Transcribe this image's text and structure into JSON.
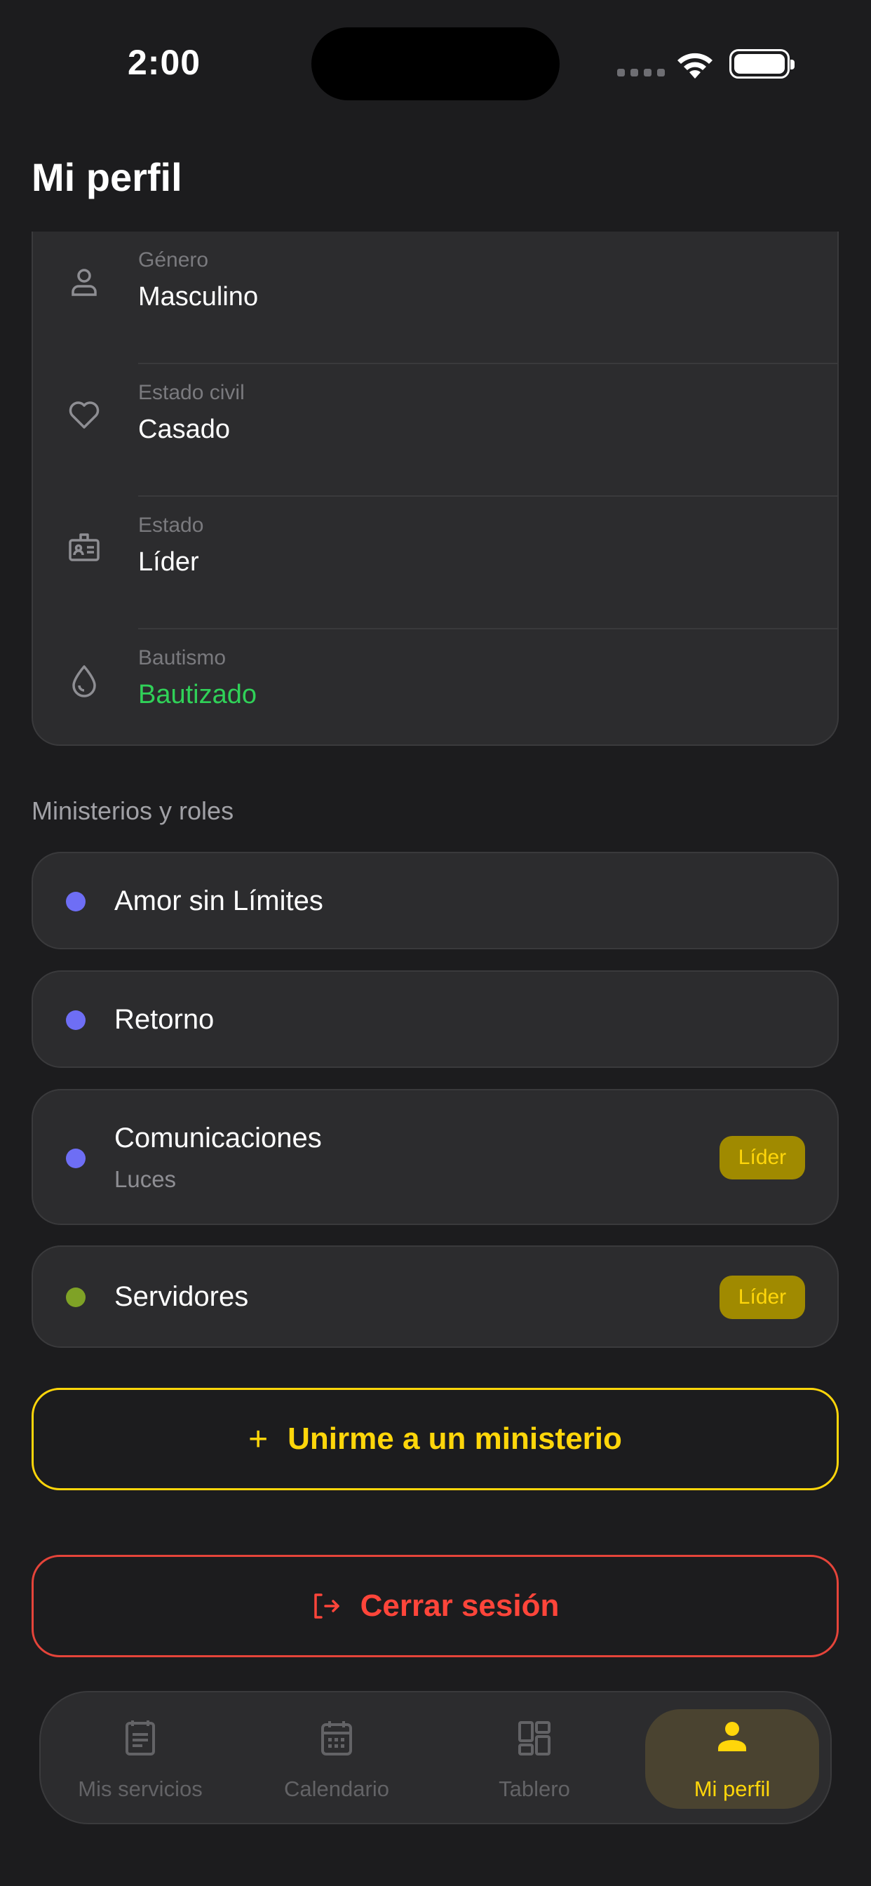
{
  "status_bar": {
    "time": "2:00"
  },
  "header": {
    "title": "Mi perfil"
  },
  "info": [
    {
      "label": "Género",
      "value": "Masculino",
      "icon": "person-icon"
    },
    {
      "label": "Estado civil",
      "value": "Casado",
      "icon": "heart-icon"
    },
    {
      "label": "Estado",
      "value": "Líder",
      "icon": "badge-icon"
    },
    {
      "label": "Bautismo",
      "value": "Bautizado",
      "icon": "drop-icon",
      "value_color": "#30d158"
    }
  ],
  "ministries_section": {
    "title": "Ministerios y roles"
  },
  "ministries": [
    {
      "name": "Amor sin Límites",
      "dot_color": "#6e6ef5"
    },
    {
      "name": "Retorno",
      "dot_color": "#6e6ef5"
    },
    {
      "name": "Comunicaciones",
      "sub": "Luces",
      "badge": "Líder",
      "dot_color": "#6e6ef5"
    },
    {
      "name": "Servidores",
      "badge": "Líder",
      "dot_color": "#7fa226"
    }
  ],
  "actions": {
    "join_icon": "+",
    "join_label": "Unirme a un ministerio",
    "logout_label": "Cerrar sesión"
  },
  "tabs": [
    {
      "label": "Mis servicios",
      "icon": "document-icon",
      "active": false
    },
    {
      "label": "Calendario",
      "icon": "calendar-icon",
      "active": false
    },
    {
      "label": "Tablero",
      "icon": "dashboard-icon",
      "active": false
    },
    {
      "label": "Mi perfil",
      "icon": "person-icon",
      "active": true
    }
  ],
  "colors": {
    "accent": "#ffd60a",
    "danger": "#ff453a",
    "success": "#30d158",
    "background": "#1c1c1e",
    "card": "#2c2c2e"
  }
}
